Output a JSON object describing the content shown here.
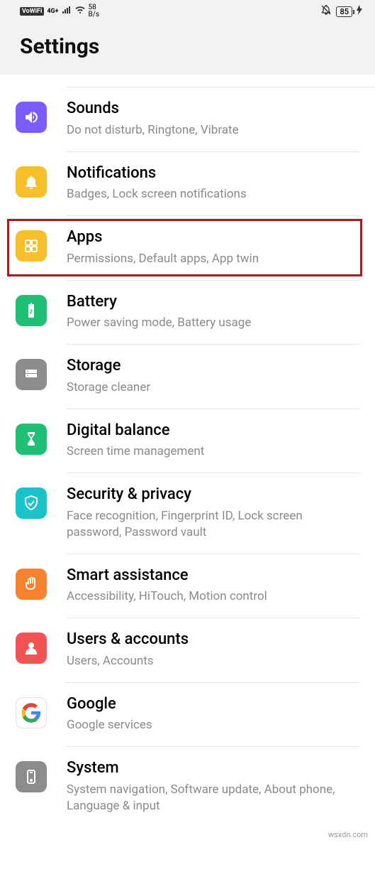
{
  "status": {
    "vowifi": "VoWiFi",
    "net": "4G+",
    "speed_top": "58",
    "speed_bottom": "B/s",
    "battery": "85",
    "charging": true
  },
  "header": {
    "title": "Settings"
  },
  "items": [
    {
      "id": "sounds",
      "title": "Sounds",
      "subtitle": "Do not disturb, Ringtone, Vibrate",
      "color": "#7b5cff"
    },
    {
      "id": "notifications",
      "title": "Notifications",
      "subtitle": "Badges, Lock screen notifications",
      "color": "#f7c02b"
    },
    {
      "id": "apps",
      "title": "Apps",
      "subtitle": "Permissions, Default apps, App twin",
      "color": "#f7c02b",
      "highlight": true
    },
    {
      "id": "battery",
      "title": "Battery",
      "subtitle": "Power saving mode, Battery usage",
      "color": "#1fbf75"
    },
    {
      "id": "storage",
      "title": "Storage",
      "subtitle": "Storage cleaner",
      "color": "#8c8c8c"
    },
    {
      "id": "digital-balance",
      "title": "Digital balance",
      "subtitle": "Screen time management",
      "color": "#1fbf75"
    },
    {
      "id": "security",
      "title": "Security & privacy",
      "subtitle": "Face recognition, Fingerprint ID, Lock screen password, Password vault",
      "color": "#19c3c9"
    },
    {
      "id": "smart-assist",
      "title": "Smart assistance",
      "subtitle": "Accessibility, HiTouch, Motion control",
      "color": "#f5822e"
    },
    {
      "id": "users",
      "title": "Users & accounts",
      "subtitle": "Users, Accounts",
      "color": "#f05454"
    },
    {
      "id": "google",
      "title": "Google",
      "subtitle": "Google services",
      "color": "google"
    },
    {
      "id": "system",
      "title": "System",
      "subtitle": "System navigation, Software update, About phone, Language & input",
      "color": "#8c8c8c"
    }
  ],
  "watermark": "wsxdn.com"
}
